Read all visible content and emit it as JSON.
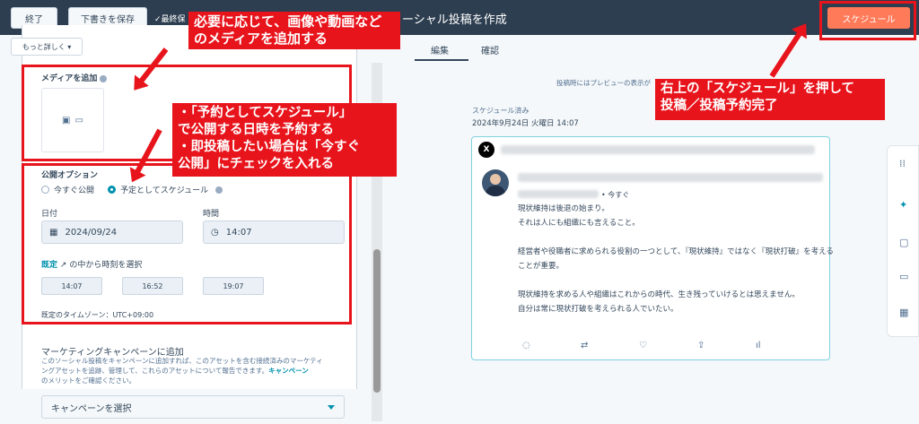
{
  "header": {
    "end_label": "終了",
    "save_draft_label": "下書きを保存",
    "autosave_label": "✓最終保",
    "page_title": "ーシャル投稿を作成",
    "schedule_label": "スケジュール"
  },
  "toolbar": {
    "more_label": "もっと詳しく ▾"
  },
  "tabs": [
    {
      "label": "編集"
    },
    {
      "label": "確認"
    }
  ],
  "media": {
    "label": "メディアを追加"
  },
  "publish": {
    "label": "公開オプション",
    "now_label": "今すぐ公開",
    "scheduled_label": "予定としてスケジュール",
    "date_label": "日付",
    "date_value": "2024/09/24",
    "time_label": "時間",
    "time_value": "14:07",
    "preset_link": "既定",
    "preset_text": "の中から時刻を選択",
    "chips": [
      "14:07",
      "16:52",
      "19:07"
    ],
    "timezone": "既定のタイムゾーン：UTC+09:00"
  },
  "marketing": {
    "title": "マーケティングキャンペーンに追加",
    "desc1": "このソーシャル投稿をキャンペーンに追加すれば、このアセットを含む接続済みのマーケティ",
    "desc2": "ングアセットを追跡、管理して、これらのアセットについて報告できます。",
    "desc_link": "キャンペーン",
    "desc3": "のメリットをご確認ください。",
    "select_placeholder": "キャンペーンを選択"
  },
  "preview": {
    "note": "投稿時にはプレビューの表示が",
    "scheduled": "スケジュール済み",
    "date": "2024年9月24日 火曜日 14:07",
    "x_icon": "X",
    "ago": "• 今すぐ",
    "lines": [
      "現状維持は後退の始まり。",
      "それは人にも組織にも言えること。",
      "経営者や役職者に求められる役割の一つとして、『現状維持』ではなく『現状打破』を考える",
      "ことが重要。",
      "現状維持を求める人や組織はこれからの時代、生き残っていけるとは思えません。",
      "自分は常に現状打破を考えられる人でいたい。"
    ]
  },
  "annotations": {
    "media": [
      "必要に応じて、画像や動画など",
      "のメディアを追加する"
    ],
    "schedule": [
      "・「予約としてスケジュール」",
      "で公開する日時を予約する",
      "・即投稿したい場合は「今すぐ",
      "公開」にチェックを入れる"
    ],
    "submit": [
      "右上の「スケジュール」を押して",
      "投稿／投稿予約完了"
    ]
  },
  "colors": {
    "accent": "#ff7a59",
    "annotation": "#e8141c",
    "topbar": "#2d3e50",
    "link": "#0091ae"
  }
}
